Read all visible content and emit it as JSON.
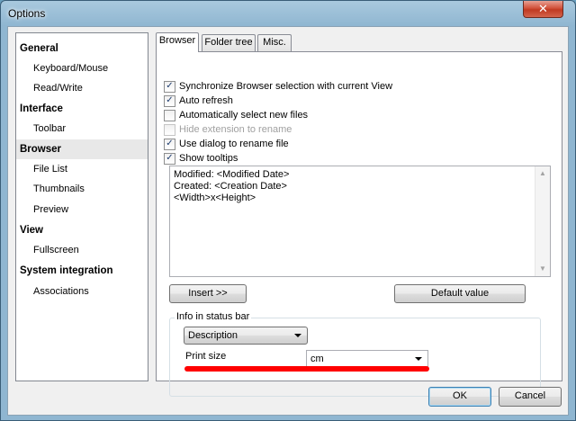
{
  "window": {
    "title": "Options",
    "close_glyph": "✕"
  },
  "sidebar": {
    "items": [
      {
        "label": "General",
        "kind": "group"
      },
      {
        "label": "Keyboard/Mouse",
        "kind": "child"
      },
      {
        "label": "Read/Write",
        "kind": "child"
      },
      {
        "label": "Interface",
        "kind": "group"
      },
      {
        "label": "Toolbar",
        "kind": "child"
      },
      {
        "label": "Browser",
        "kind": "group",
        "selected": true
      },
      {
        "label": "File List",
        "kind": "child"
      },
      {
        "label": "Thumbnails",
        "kind": "child"
      },
      {
        "label": "Preview",
        "kind": "child"
      },
      {
        "label": "View",
        "kind": "group"
      },
      {
        "label": "Fullscreen",
        "kind": "child"
      },
      {
        "label": "System integration",
        "kind": "group"
      },
      {
        "label": "Associations",
        "kind": "child"
      }
    ]
  },
  "tabs": [
    {
      "label": "Browser",
      "active": true
    },
    {
      "label": "Folder tree",
      "active": false
    },
    {
      "label": "Misc.",
      "active": false
    }
  ],
  "browser_tab": {
    "checkboxes": [
      {
        "label": "Synchronize Browser selection with current View",
        "checked": true,
        "enabled": true
      },
      {
        "label": "Auto refresh",
        "checked": true,
        "enabled": true
      },
      {
        "label": "Automatically select new files",
        "checked": false,
        "enabled": true
      },
      {
        "label": "Hide extension to rename",
        "checked": false,
        "enabled": false
      },
      {
        "label": "Use dialog to rename file",
        "checked": true,
        "enabled": true
      },
      {
        "label": "Show tooltips",
        "checked": true,
        "enabled": true
      }
    ],
    "tooltip_template": {
      "lines": [
        "Modified: <Modified Date>",
        "Created: <Creation Date>",
        "<Width>x<Height>"
      ]
    },
    "insert_button": "Insert >>",
    "default_value_button": "Default value",
    "status_bar_group": {
      "label": "Info in status bar",
      "field_select": "Description",
      "print_size_label": "Print size",
      "print_size_select": "cm"
    }
  },
  "footer": {
    "ok_button": "OK",
    "cancel_button": "Cancel"
  },
  "colors": {
    "annotation_underline": "#ff0000",
    "selected_item_bg": "#e8e8e8"
  }
}
